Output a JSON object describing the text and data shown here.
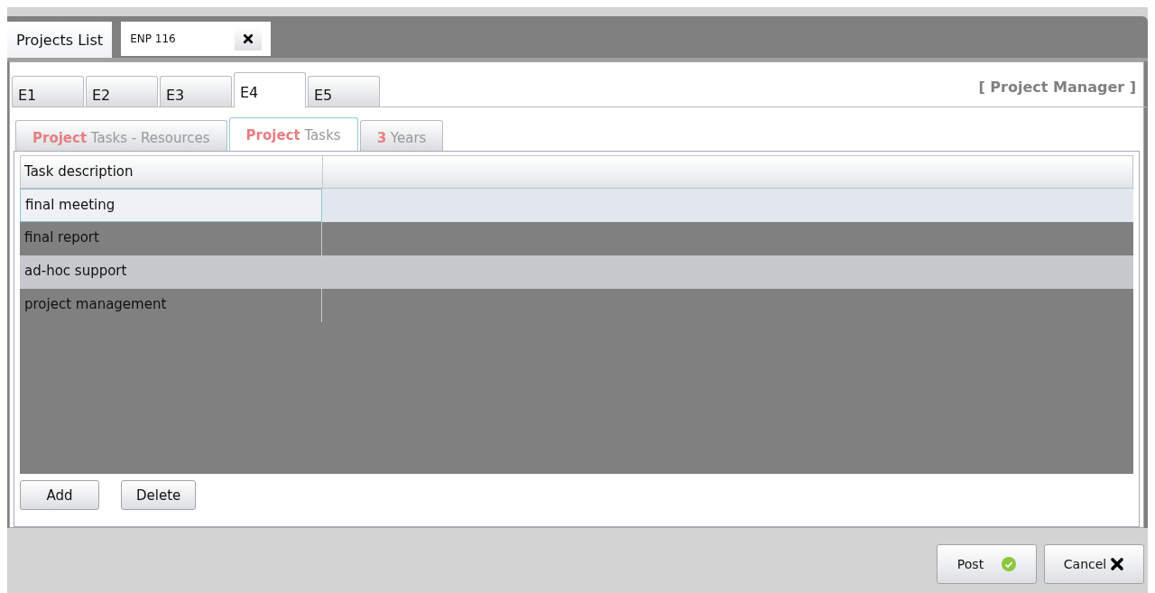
{
  "doc_tabs": [
    {
      "label": "Projects List",
      "closable": false,
      "selected": false
    },
    {
      "label": "ENP 116",
      "closable": true,
      "selected": true
    }
  ],
  "entity_tabs": [
    {
      "label": "E1",
      "selected": false
    },
    {
      "label": "E2",
      "selected": false
    },
    {
      "label": "E3",
      "selected": false
    },
    {
      "label": "E4",
      "selected": true
    },
    {
      "label": "E5",
      "selected": false
    }
  ],
  "role": "[ Project Manager ]",
  "sub_tabs": [
    {
      "label": "**Project** Tasks - Resources",
      "selected": false
    },
    {
      "label": "**Project** Tasks",
      "selected": true
    },
    {
      "label": "**3** Years",
      "selected": false
    }
  ],
  "table": {
    "columns": [
      "Task description"
    ],
    "rows": [
      {
        "cells": [
          "final meeting"
        ],
        "selected": true,
        "hovered": false
      },
      {
        "cells": [
          "final report"
        ],
        "selected": false,
        "hovered": false
      },
      {
        "cells": [
          "ad-hoc support"
        ],
        "selected": false,
        "hovered": true
      },
      {
        "cells": [
          "project management"
        ],
        "selected": false,
        "hovered": false
      }
    ]
  },
  "grid_buttons": [
    "Add",
    "Delete"
  ],
  "footer_buttons": [
    {
      "label": "Post",
      "kind": "post"
    },
    {
      "label": "Cancel",
      "kind": "cancel"
    }
  ]
}
